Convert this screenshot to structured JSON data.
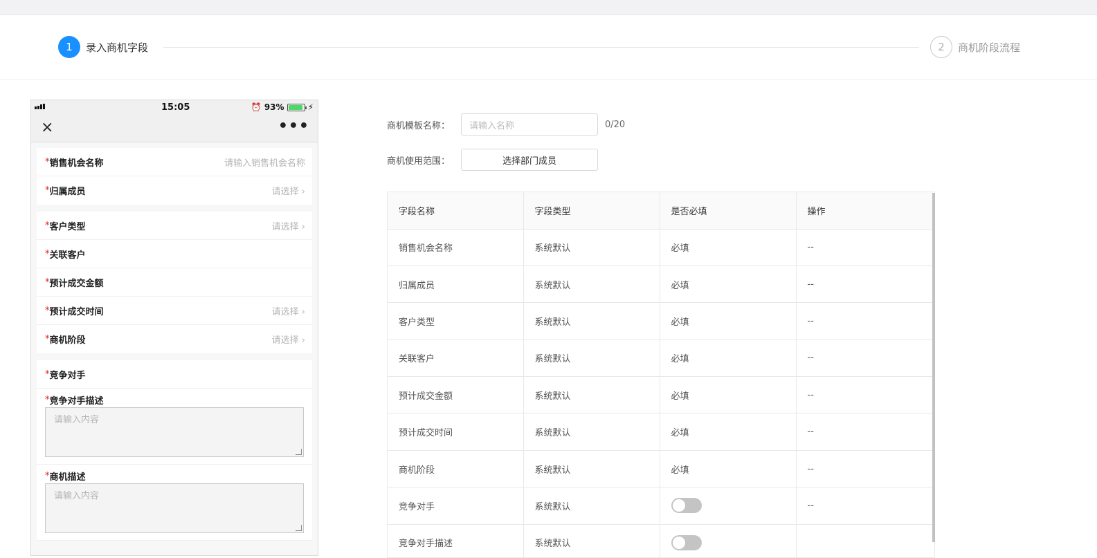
{
  "steps": [
    {
      "num": "1",
      "label": "录入商机字段"
    },
    {
      "num": "2",
      "label": "商机阶段流程"
    }
  ],
  "phone": {
    "time": "15:05",
    "battery": "93%",
    "close_glyph": "×",
    "more_glyph": "•••",
    "groups": [
      {
        "rows": [
          {
            "label": "销售机会名称",
            "value": "请输入销售机会名称"
          },
          {
            "label": "归属成员",
            "value": "请选择 ›"
          }
        ]
      },
      {
        "rows": [
          {
            "label": "客户类型",
            "value": "请选择 ›"
          },
          {
            "label": "关联客户",
            "value": ""
          },
          {
            "label": "预计成交金额",
            "value": ""
          },
          {
            "label": "预计成交时间",
            "value": "请选择 ›"
          },
          {
            "label": "商机阶段",
            "value": "请选择 ›"
          }
        ]
      }
    ],
    "competitor_label": "竞争对手",
    "textareas": [
      {
        "label": "竞争对手描述",
        "placeholder": "请输入内容"
      },
      {
        "label": "商机描述",
        "placeholder": "请输入内容"
      }
    ],
    "required_mark": "*"
  },
  "form": {
    "template_name_label": "商机模板名称：",
    "template_name_placeholder": "请输入名称",
    "template_name_counter": "0/20",
    "scope_label": "商机使用范围：",
    "scope_button": "选择部门成员"
  },
  "table": {
    "headers": [
      "字段名称",
      "字段类型",
      "是否必填",
      "操作"
    ],
    "rows": [
      {
        "name": "销售机会名称",
        "type": "系统默认",
        "required": "必填",
        "action": "--"
      },
      {
        "name": "归属成员",
        "type": "系统默认",
        "required": "必填",
        "action": "--"
      },
      {
        "name": "客户类型",
        "type": "系统默认",
        "required": "必填",
        "action": "--"
      },
      {
        "name": "关联客户",
        "type": "系统默认",
        "required": "必填",
        "action": "--"
      },
      {
        "name": "预计成交金额",
        "type": "系统默认",
        "required": "必填",
        "action": "--"
      },
      {
        "name": "预计成交时间",
        "type": "系统默认",
        "required": "必填",
        "action": "--"
      },
      {
        "name": "商机阶段",
        "type": "系统默认",
        "required": "必填",
        "action": "--"
      },
      {
        "name": "竞争对手",
        "type": "系统默认",
        "required": "",
        "action": "--"
      },
      {
        "name": "竞争对手描述",
        "type": "系统默认",
        "required": "",
        "action": ""
      }
    ]
  },
  "colors": {
    "accent": "#1890ff",
    "required": "#e02020"
  }
}
